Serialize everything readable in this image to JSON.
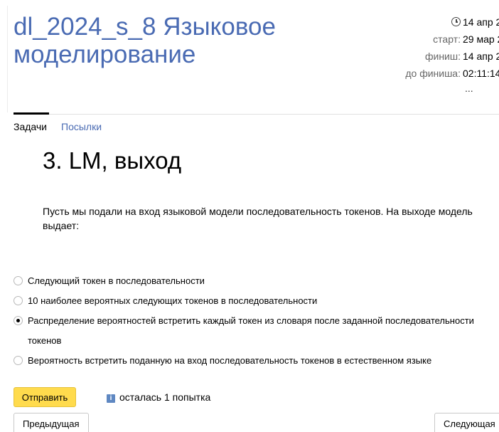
{
  "contest": {
    "title": "dl_2024_s_8 Языковое моделирование"
  },
  "info": {
    "current_date": "14 апр 2",
    "start_label": "старт:",
    "start_value": "29 мар 2",
    "finish_label": "финиш:",
    "finish_value": "14 апр 2",
    "remaining_label": "до финиша:",
    "remaining_value": "02:11:14",
    "more": "..."
  },
  "tabs": [
    {
      "label": "Задачи",
      "active": true
    },
    {
      "label": "Посылки",
      "active": false
    }
  ],
  "problem": {
    "title": "3. LM, выход",
    "statement": "Пусть мы подали на вход языковой модели последовательность токенов. На выходе модель выдает:",
    "options": [
      {
        "label": "Следующий токен в последовательности",
        "selected": false
      },
      {
        "label": "10 наиболее вероятных следующих токенов в последовательности",
        "selected": false
      },
      {
        "label": "Распределение вероятностей встретить каждый токен из словаря после заданной последовательности токенов",
        "selected": true
      },
      {
        "label": "Вероятность встретить поданную на вход последовательность токенов в естественном языке",
        "selected": false
      }
    ]
  },
  "actions": {
    "submit_label": "Отправить",
    "attempts_text": "осталась 1 попытка",
    "prev_label": "Предыдущая",
    "next_label": "Следующая"
  },
  "colors": {
    "link": "#4a6bb3",
    "submit": "#ffdb4d",
    "info_icon": "#5f88c2"
  }
}
